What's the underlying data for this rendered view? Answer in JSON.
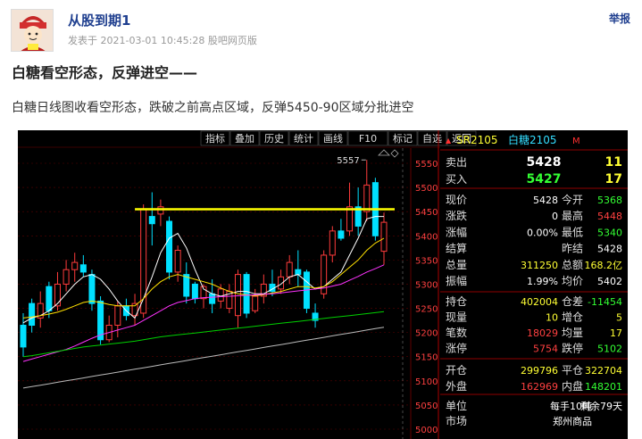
{
  "post": {
    "author": "从股到期1",
    "meta": "发表于 2021-03-01 10:45:28 股吧网页版",
    "report": "举报",
    "title": "白糖看空形态，反弹进空——",
    "body": "白糖日线图收看空形态，跌破之前高点区域，反弹5450-90区域分批进空"
  },
  "colors": {
    "up": "#ff3b3b",
    "down": "#00e0ff",
    "ma5": "#ffffff",
    "ma10": "#ffe000",
    "ma20": "#ff33ff",
    "ma60": "#00d000",
    "ma120": "#bbbbbb",
    "line": "#ffff00",
    "yellow": "#ffff44",
    "green": "#33ff33",
    "cyan": "#33ccff"
  },
  "toolbar": [
    "指标",
    "叠加",
    "历史",
    "统计",
    "画线",
    "F10",
    "标记",
    "自选",
    "返回"
  ],
  "price_axis": [
    "5550",
    "5500",
    "5450",
    "5400",
    "5350",
    "5300",
    "5250",
    "5200",
    "5150",
    "5100",
    "5050",
    "5000"
  ],
  "peak_label": "5557",
  "hline_price": 5455,
  "quote": {
    "code": "SR2105",
    "name": "白糖2105",
    "flag": "M",
    "sell": {
      "label": "卖出",
      "price": "5428",
      "vol": "11"
    },
    "buy": {
      "label": "买入",
      "price": "5427",
      "vol": "17"
    },
    "rows1": [
      [
        "现价",
        "5428",
        "今开",
        "5368"
      ],
      [
        "涨跌",
        "0",
        "最高",
        "5448"
      ],
      [
        "涨幅",
        "0.00%",
        "最低",
        "5340"
      ],
      [
        "结算",
        "",
        "昨结",
        "5428"
      ],
      [
        "总量",
        "311250",
        "总额",
        "168.2亿"
      ],
      [
        "振幅",
        "1.99%",
        "均价",
        "5402"
      ]
    ],
    "rows2": [
      [
        "持仓",
        "402004",
        "仓差",
        "-11454"
      ],
      [
        "现量",
        "10",
        "增仓",
        "5"
      ],
      [
        "笔数",
        "18029",
        "均量",
        "17"
      ],
      [
        "涨停",
        "5754",
        "跌停",
        "5102"
      ]
    ],
    "rows3": [
      [
        "开仓",
        "299796",
        "平仓",
        "322704"
      ],
      [
        "外盘",
        "162969",
        "内盘",
        "148201"
      ]
    ],
    "rows4": [
      [
        "单位",
        "每手10吨",
        "剩余79天"
      ],
      [
        "市场",
        "郑州商品",
        ""
      ]
    ]
  },
  "chart_data": {
    "type": "candlestick",
    "price_range": [
      5000,
      5580
    ],
    "candles": [
      {
        "o": 5215,
        "c": 5170,
        "h": 5240,
        "l": 5150
      },
      {
        "o": 5260,
        "c": 5215,
        "h": 5270,
        "l": 5200
      },
      {
        "o": 5230,
        "c": 5260,
        "h": 5285,
        "l": 5210
      },
      {
        "o": 5295,
        "c": 5245,
        "h": 5305,
        "l": 5230
      },
      {
        "o": 5255,
        "c": 5300,
        "h": 5325,
        "l": 5245
      },
      {
        "o": 5300,
        "c": 5330,
        "h": 5350,
        "l": 5285
      },
      {
        "o": 5330,
        "c": 5345,
        "h": 5365,
        "l": 5305
      },
      {
        "o": 5340,
        "c": 5325,
        "h": 5360,
        "l": 5315
      },
      {
        "o": 5320,
        "c": 5260,
        "h": 5330,
        "l": 5245
      },
      {
        "o": 5265,
        "c": 5185,
        "h": 5275,
        "l": 5175
      },
      {
        "o": 5185,
        "c": 5215,
        "h": 5235,
        "l": 5180
      },
      {
        "o": 5215,
        "c": 5255,
        "h": 5265,
        "l": 5190
      },
      {
        "o": 5255,
        "c": 5235,
        "h": 5270,
        "l": 5225
      },
      {
        "o": 5235,
        "c": 5260,
        "h": 5280,
        "l": 5215
      },
      {
        "o": 5240,
        "c": 5455,
        "h": 5465,
        "l": 5230
      },
      {
        "o": 5440,
        "c": 5425,
        "h": 5490,
        "l": 5380
      },
      {
        "o": 5445,
        "c": 5460,
        "h": 5475,
        "l": 5420
      },
      {
        "o": 5430,
        "c": 5325,
        "h": 5440,
        "l": 5310
      },
      {
        "o": 5325,
        "c": 5370,
        "h": 5380,
        "l": 5305
      },
      {
        "o": 5320,
        "c": 5275,
        "h": 5345,
        "l": 5260
      },
      {
        "o": 5300,
        "c": 5270,
        "h": 5305,
        "l": 5260
      },
      {
        "o": 5270,
        "c": 5295,
        "h": 5300,
        "l": 5250
      },
      {
        "o": 5280,
        "c": 5260,
        "h": 5310,
        "l": 5240
      },
      {
        "o": 5265,
        "c": 5290,
        "h": 5300,
        "l": 5250
      },
      {
        "o": 5250,
        "c": 5285,
        "h": 5300,
        "l": 5240
      },
      {
        "o": 5235,
        "c": 5320,
        "h": 5330,
        "l": 5210
      },
      {
        "o": 5320,
        "c": 5240,
        "h": 5325,
        "l": 5230
      },
      {
        "o": 5245,
        "c": 5275,
        "h": 5290,
        "l": 5240
      },
      {
        "o": 5275,
        "c": 5300,
        "h": 5320,
        "l": 5260
      },
      {
        "o": 5300,
        "c": 5285,
        "h": 5330,
        "l": 5275
      },
      {
        "o": 5290,
        "c": 5315,
        "h": 5330,
        "l": 5280
      },
      {
        "o": 5315,
        "c": 5345,
        "h": 5360,
        "l": 5300
      },
      {
        "o": 5330,
        "c": 5320,
        "h": 5370,
        "l": 5295
      },
      {
        "o": 5325,
        "c": 5250,
        "h": 5330,
        "l": 5240
      },
      {
        "o": 5240,
        "c": 5225,
        "h": 5260,
        "l": 5210
      },
      {
        "o": 5280,
        "c": 5360,
        "h": 5370,
        "l": 5270
      },
      {
        "o": 5360,
        "c": 5410,
        "h": 5420,
        "l": 5345
      },
      {
        "o": 5410,
        "c": 5395,
        "h": 5435,
        "l": 5390
      },
      {
        "o": 5410,
        "c": 5460,
        "h": 5510,
        "l": 5400
      },
      {
        "o": 5460,
        "c": 5420,
        "h": 5500,
        "l": 5400
      },
      {
        "o": 5450,
        "c": 5505,
        "h": 5557,
        "l": 5430
      },
      {
        "o": 5510,
        "c": 5400,
        "h": 5520,
        "l": 5390
      },
      {
        "o": 5368,
        "c": 5428,
        "h": 5448,
        "l": 5340
      }
    ],
    "moving_averages": [
      {
        "name": "MA5",
        "values": [
          5220,
          5230,
          5235,
          5245,
          5260,
          5280,
          5300,
          5315,
          5320,
          5310,
          5290,
          5265,
          5245,
          5230,
          5270,
          5315,
          5365,
          5395,
          5405,
          5375,
          5330,
          5290,
          5280,
          5275,
          5280,
          5285,
          5285,
          5280,
          5280,
          5290,
          5300,
          5315,
          5320,
          5305,
          5290,
          5295,
          5310,
          5325,
          5360,
          5395,
          5435,
          5440,
          5440
        ]
      },
      {
        "name": "MA10",
        "values": [
          5230,
          5232,
          5235,
          5238,
          5242,
          5248,
          5255,
          5262,
          5265,
          5262,
          5258,
          5255,
          5255,
          5255,
          5270,
          5290,
          5305,
          5315,
          5320,
          5315,
          5310,
          5305,
          5300,
          5292,
          5285,
          5280,
          5278,
          5276,
          5278,
          5282,
          5285,
          5290,
          5295,
          5295,
          5292,
          5295,
          5305,
          5320,
          5335,
          5350,
          5370,
          5385,
          5395
        ]
      },
      {
        "name": "MA20",
        "values": [
          5140,
          5145,
          5150,
          5155,
          5160,
          5165,
          5172,
          5180,
          5188,
          5195,
          5200,
          5205,
          5210,
          5215,
          5225,
          5235,
          5245,
          5255,
          5262,
          5266,
          5270,
          5272,
          5273,
          5274,
          5275,
          5276,
          5277,
          5278,
          5279,
          5280,
          5282,
          5284,
          5286,
          5288,
          5290,
          5292,
          5296,
          5300,
          5308,
          5316,
          5325,
          5332,
          5340
        ]
      },
      {
        "name": "MA60",
        "values": [
          5150,
          5152,
          5155,
          5158,
          5161,
          5164,
          5167,
          5170,
          5172,
          5174,
          5176,
          5178,
          5180,
          5182,
          5185,
          5188,
          5191,
          5193,
          5195,
          5197,
          5199,
          5201,
          5203,
          5205,
          5207,
          5209,
          5211,
          5213,
          5215,
          5217,
          5219,
          5221,
          5223,
          5225,
          5227,
          5229,
          5231,
          5233,
          5235,
          5237,
          5239,
          5241,
          5243
        ]
      },
      {
        "name": "MA120",
        "values": [
          5085,
          5088,
          5091,
          5094,
          5097,
          5100,
          5103,
          5106,
          5109,
          5112,
          5115,
          5118,
          5121,
          5124,
          5127,
          5130,
          5133,
          5136,
          5139,
          5142,
          5145,
          5148,
          5151,
          5154,
          5157,
          5160,
          5163,
          5166,
          5169,
          5172,
          5175,
          5178,
          5181,
          5184,
          5187,
          5190,
          5193,
          5196,
          5199,
          5202,
          5205,
          5208,
          5211
        ]
      }
    ]
  }
}
